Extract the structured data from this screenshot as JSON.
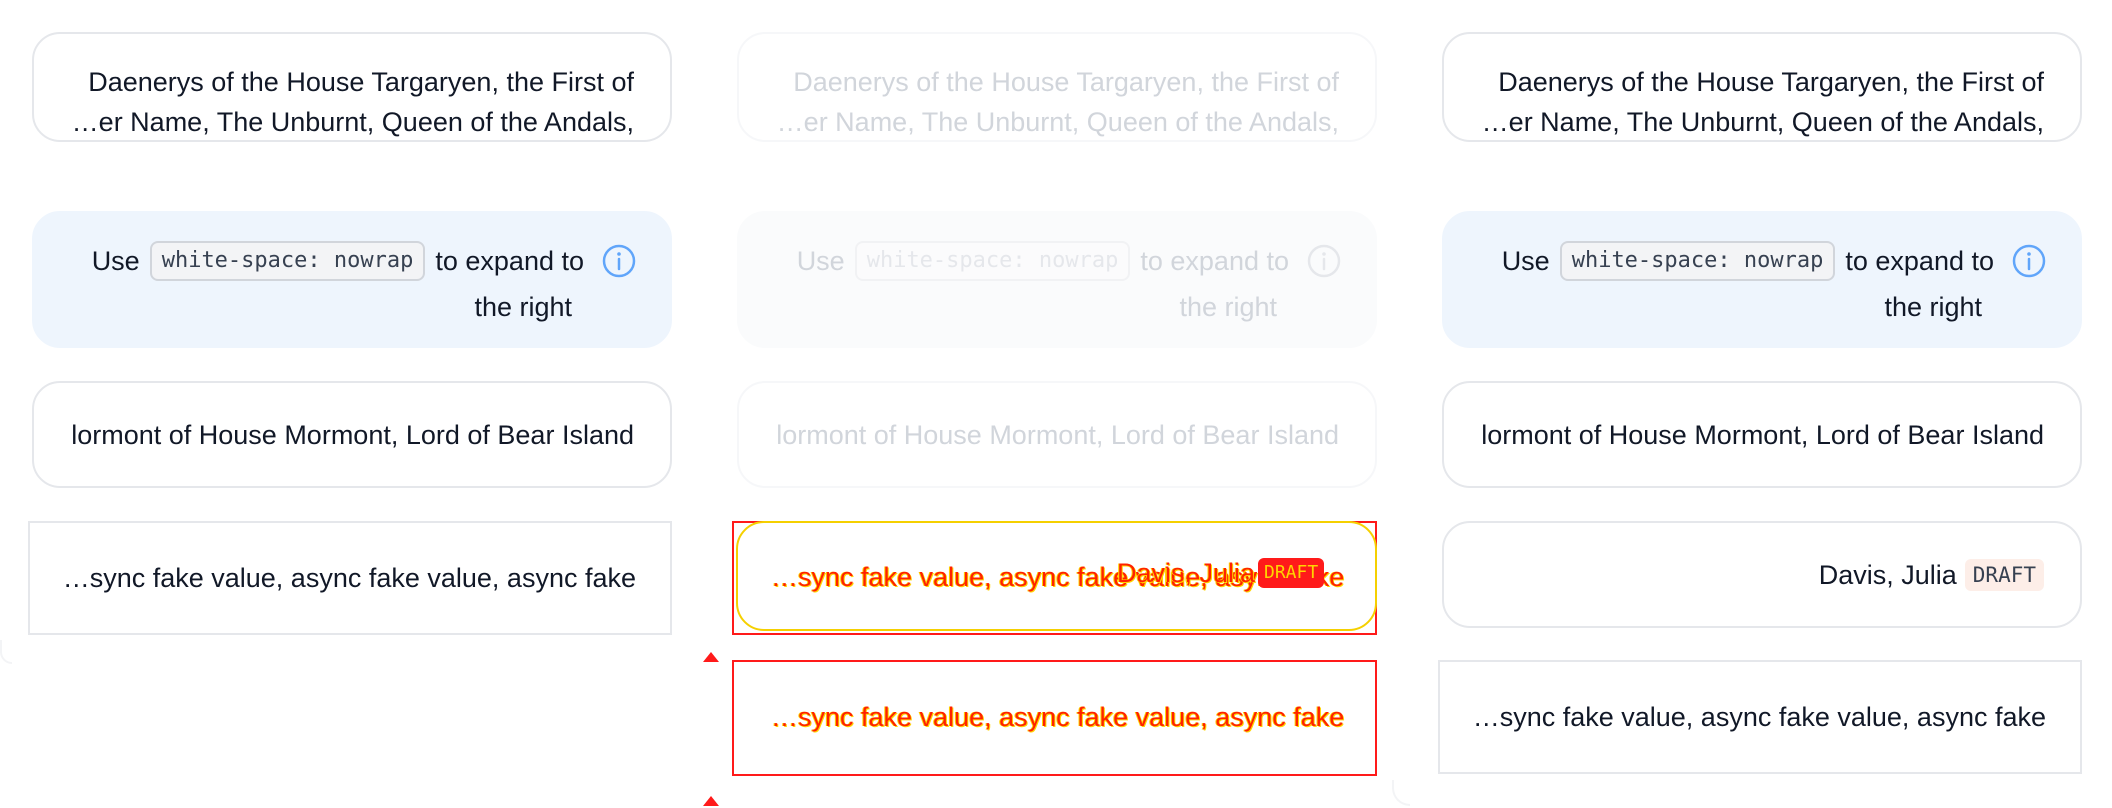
{
  "cards": {
    "daenerys_line1": "Daenerys of the House Targaryen, the First of",
    "daenerys_line2": "…er Name, The Unburnt, Queen of the Andals,",
    "note_prefix": "Use",
    "note_code": "white-space: nowrap",
    "note_suffix": "to expand to",
    "note_line2": "the right",
    "mormont": "lormont of House Mormont, Lord of Bear Island",
    "async_value": "…sync fake value, async fake value, async fake",
    "person_name": "Davis, Julia",
    "draft_badge": "DRAFT"
  },
  "icons": {
    "info": "info-circle-icon"
  },
  "colors": {
    "text": "#111827",
    "note_background": "#eef5fd",
    "info_icon": "#60a5fa",
    "code_background": "#f3f4f6",
    "draft_background": "#fdeee8",
    "error_outline": "#ff1a1a",
    "error_text": "#ff2200",
    "error_highlight": "#ffd400"
  }
}
